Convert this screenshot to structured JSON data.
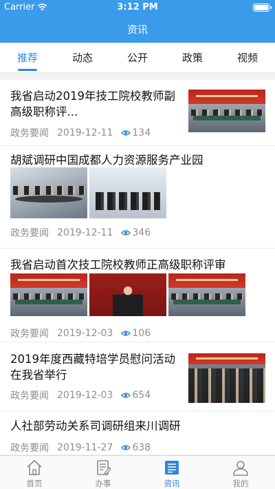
{
  "status": {
    "carrier": "Carrier",
    "time": "3:12 PM"
  },
  "nav": {
    "title": "资讯"
  },
  "tabs": [
    "推荐",
    "动态",
    "公开",
    "政策",
    "视频"
  ],
  "active_tab": 0,
  "news": [
    {
      "title": "我省启动2019年技工院校教师副高级职称评...",
      "source": "政务要闻",
      "date": "2019-12-11",
      "views": "134"
    },
    {
      "title": "胡斌调研中国成都人力资源服务产业园",
      "source": "政务要闻",
      "date": "2019-12-11",
      "views": "346"
    },
    {
      "title": "我省启动首次技工院校教师正高级职称评审",
      "source": "政务要闻",
      "date": "2019-12-03",
      "views": "106"
    },
    {
      "title": "2019年度西藏特培学员慰问活动在我省举行",
      "source": "政务要闻",
      "date": "2019-12-03",
      "views": "654"
    },
    {
      "title": "人社部劳动关系司调研组来川调研",
      "source": "政务要闻",
      "date": "2019-11-27",
      "views": "638"
    }
  ],
  "tabbar": [
    {
      "label": "首页",
      "icon": "home-icon"
    },
    {
      "label": "办事",
      "icon": "document-edit-icon"
    },
    {
      "label": "资讯",
      "icon": "news-icon"
    },
    {
      "label": "我的",
      "icon": "person-icon"
    }
  ],
  "colors": {
    "primary": "#3a9bea",
    "active": "#2f86d8",
    "meta": "#8e8e8e"
  }
}
